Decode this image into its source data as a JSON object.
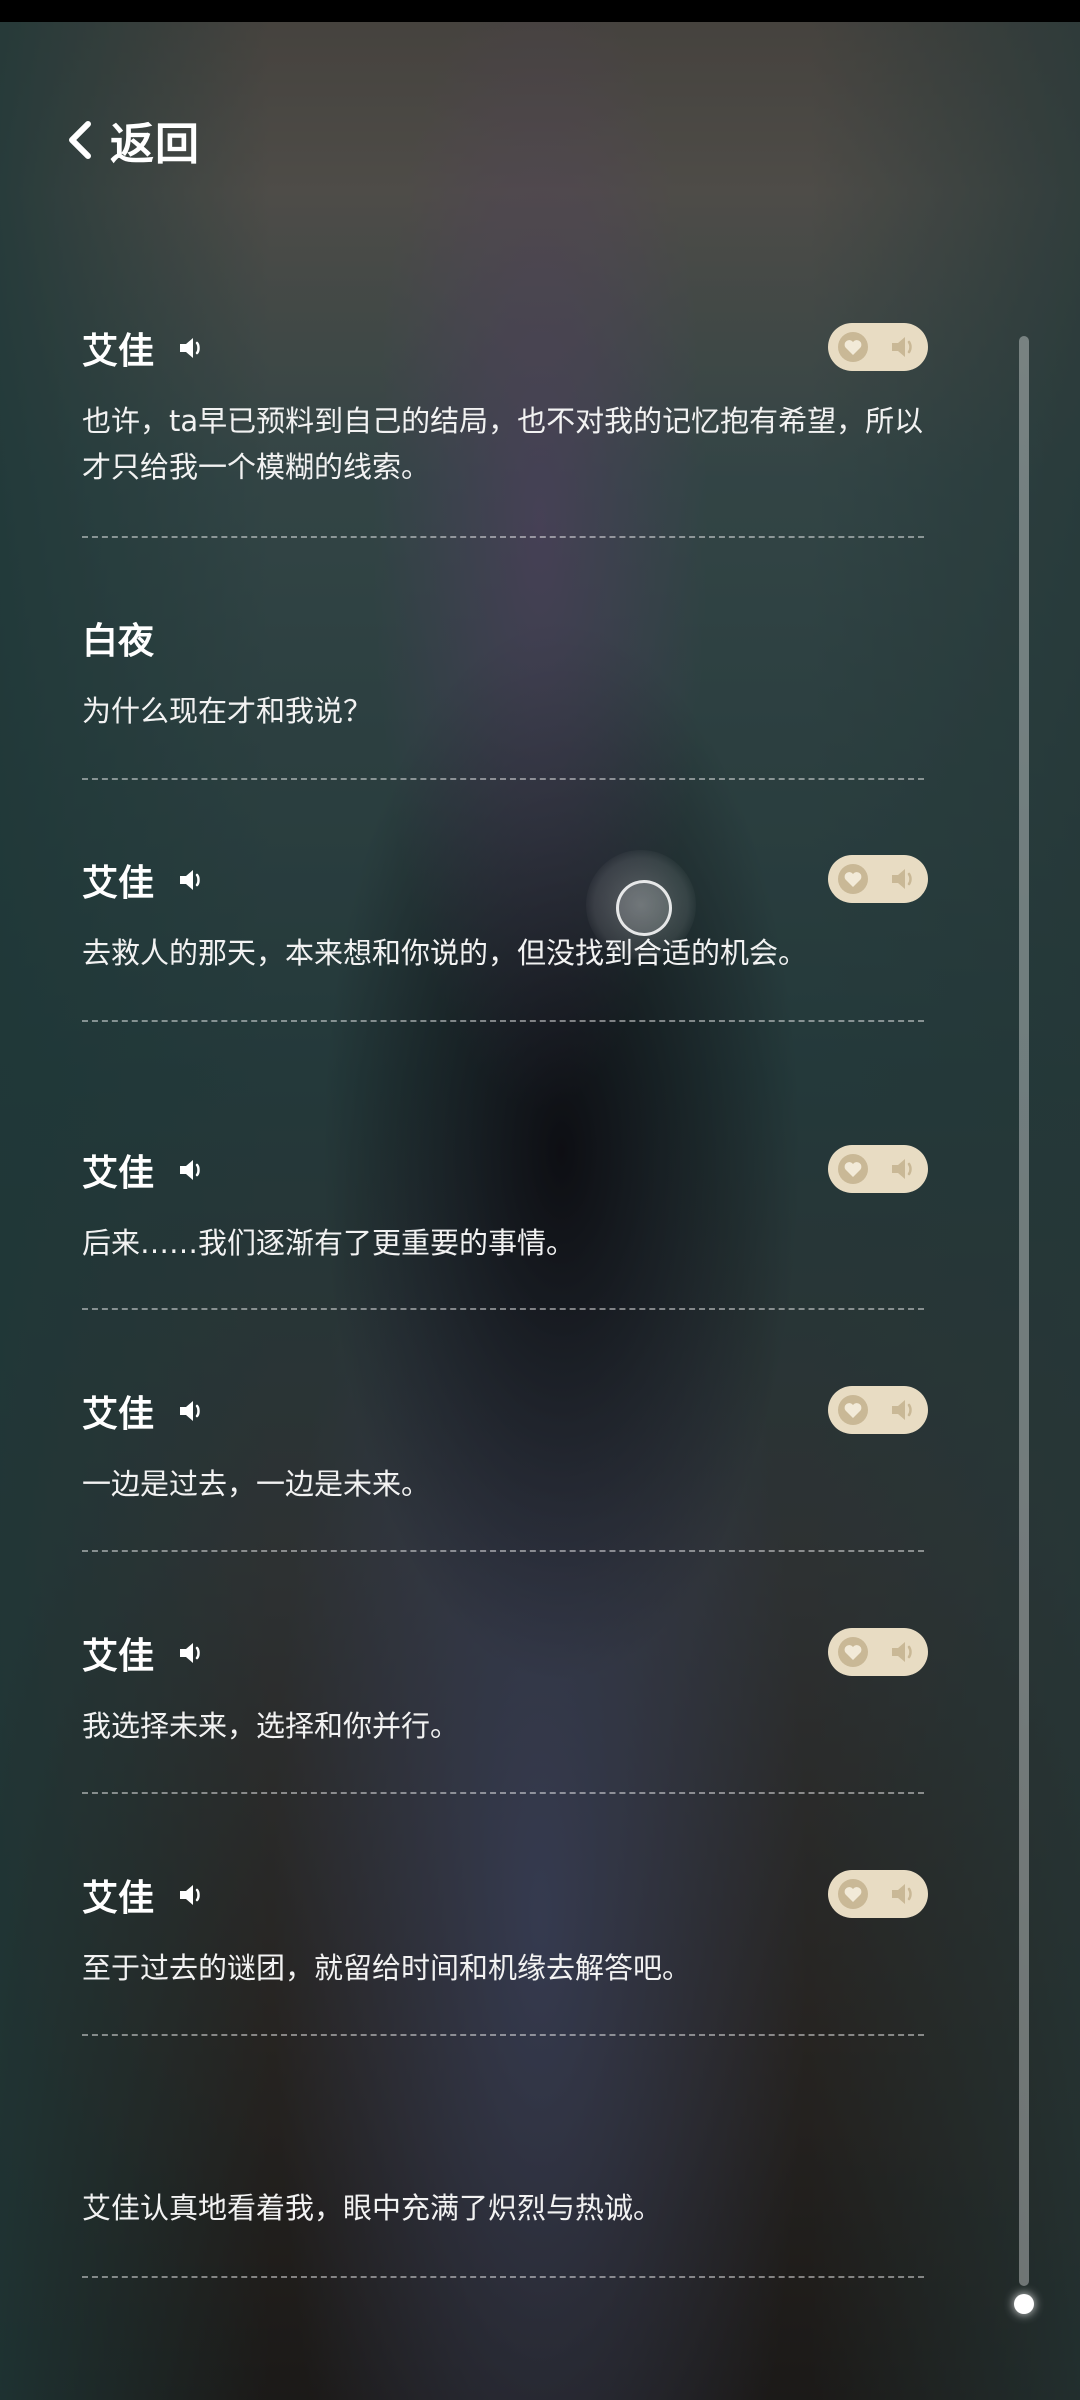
{
  "header": {
    "back_label": "返回",
    "back_icon": "chevron-left-icon"
  },
  "dialogue": [
    {
      "speaker": "艾佳",
      "has_voice": true,
      "text": "也许，ta早已预料到自己的结局，也不对我的记忆抱有希望，所以才只给我一个模糊的线索。"
    },
    {
      "speaker": "白夜",
      "has_voice": false,
      "text": "为什么现在才和我说？"
    },
    {
      "speaker": "艾佳",
      "has_voice": true,
      "text": "去救人的那天，本来想和你说的，但没找到合适的机会。"
    },
    {
      "speaker": "艾佳",
      "has_voice": true,
      "text": "后来……我们逐渐有了更重要的事情。"
    },
    {
      "speaker": "艾佳",
      "has_voice": true,
      "text": "一边是过去，一边是未来。"
    },
    {
      "speaker": "艾佳",
      "has_voice": true,
      "text": "我选择未来，选择和你并行。"
    },
    {
      "speaker": "艾佳",
      "has_voice": true,
      "text": "至于过去的谜团，就留给时间和机缘去解答吧。"
    },
    {
      "speaker": "",
      "has_voice": false,
      "text": "艾佳认真地看着我，眼中充满了炽烈与热诚。"
    }
  ],
  "pill_icons": [
    "heart-icon",
    "speaker-icon"
  ],
  "colors": {
    "pill": "#e8dcc3",
    "pill_icon": "#c9b896",
    "text": "#ffffff"
  },
  "scroll_position": 1.0
}
